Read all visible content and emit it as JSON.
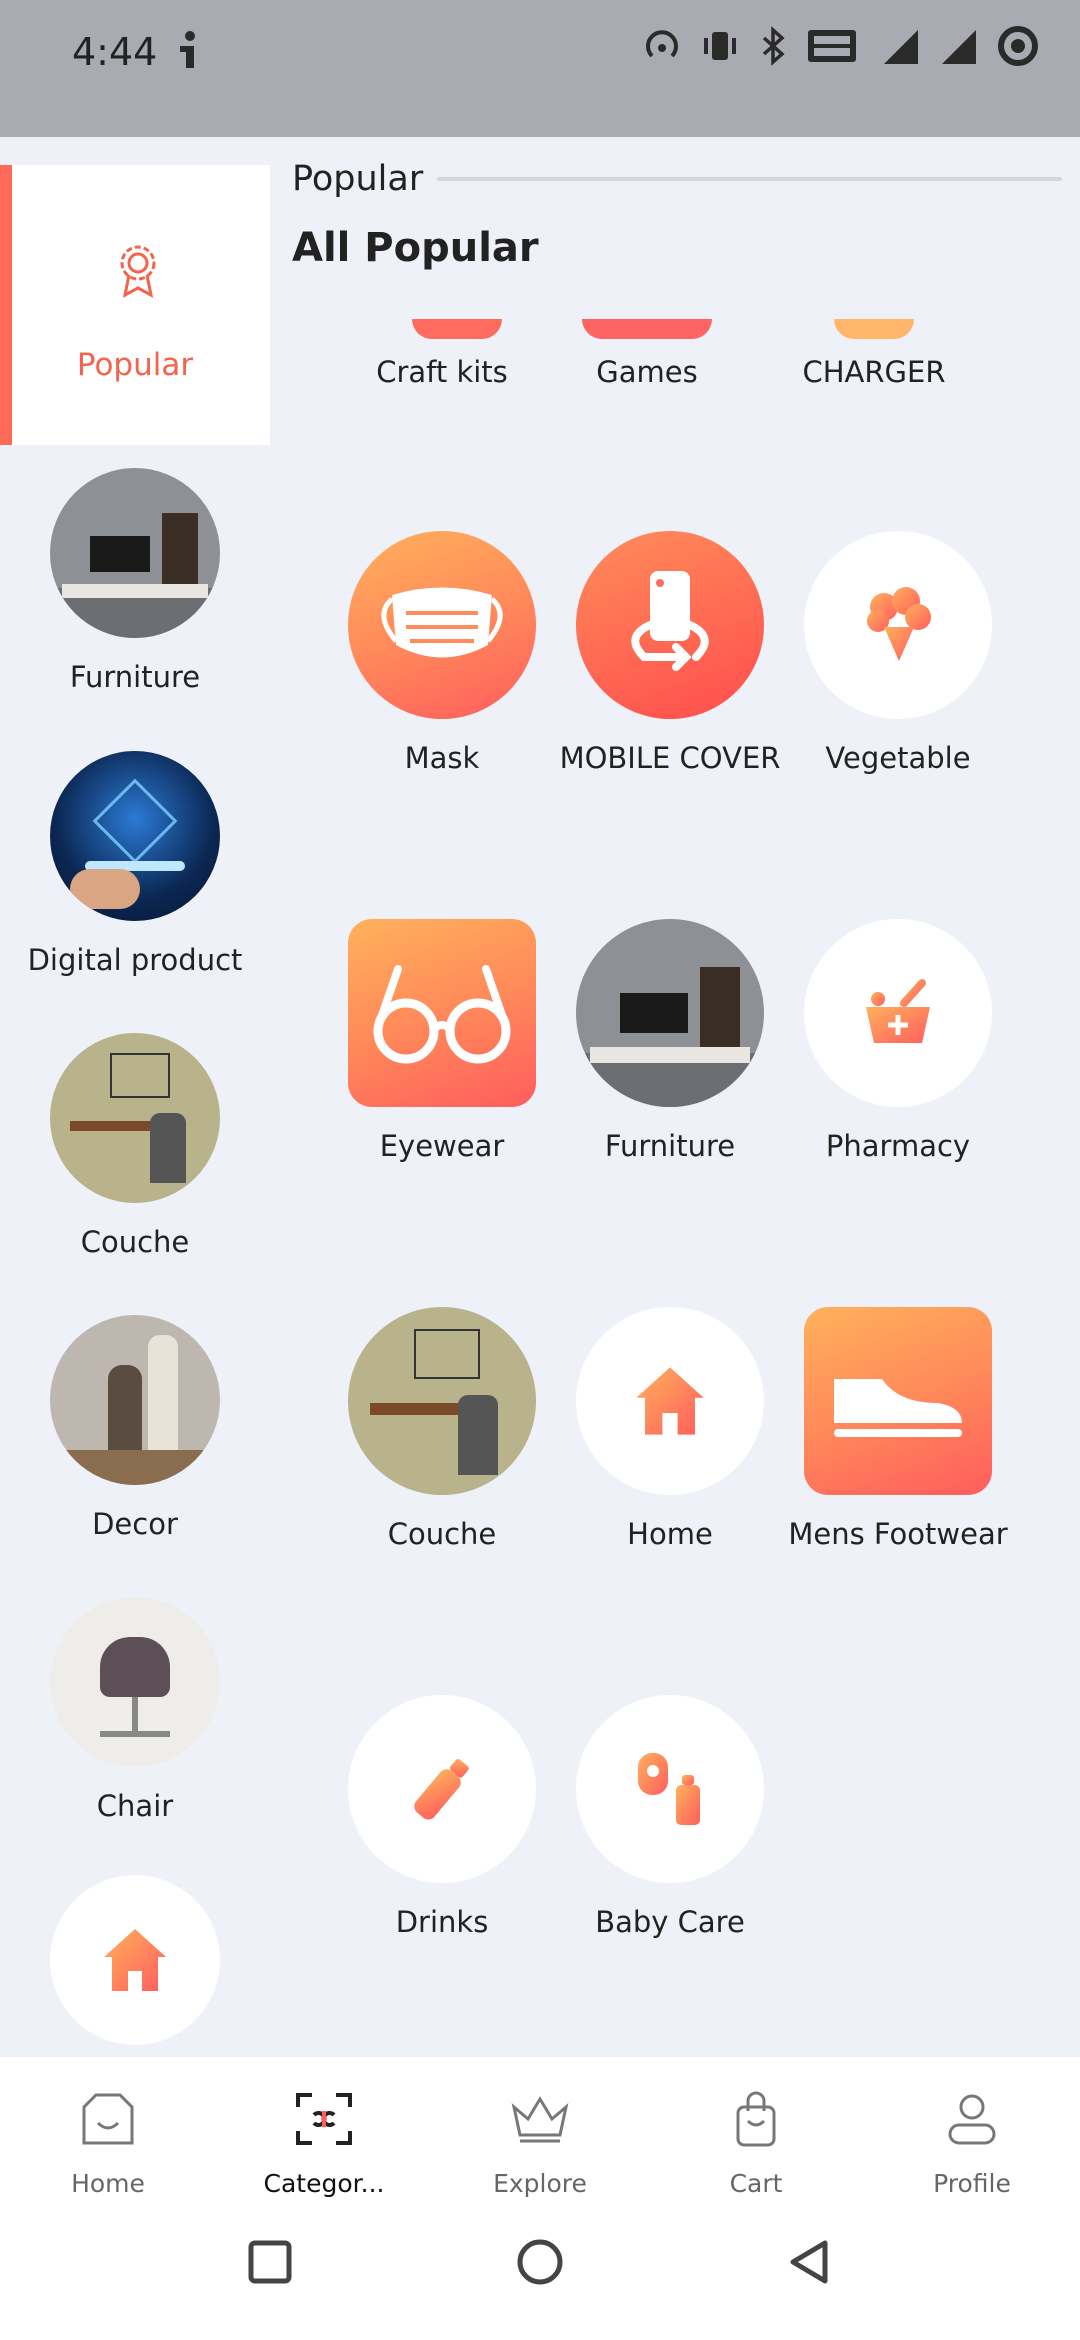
{
  "status_bar": {
    "time": "4:44"
  },
  "sidebar": {
    "active": {
      "label": "Popular"
    },
    "items": [
      {
        "label": "Furniture"
      },
      {
        "label": "Digital product"
      },
      {
        "label": "Couche"
      },
      {
        "label": "Decor"
      },
      {
        "label": "Chair"
      },
      {
        "label": ""
      }
    ]
  },
  "main": {
    "header_title": "Popular",
    "subtitle": "All Popular",
    "partial_row": [
      "Craft kits",
      "Games",
      "CHARGER"
    ],
    "grid": [
      {
        "label": "Mask",
        "icon": "mask-icon"
      },
      {
        "label": "MOBILE COVER",
        "icon": "mobile-cover-icon"
      },
      {
        "label": "Vegetable",
        "icon": "vegetable-icon"
      },
      {
        "label": "Eyewear",
        "icon": "eyewear-icon"
      },
      {
        "label": "Furniture",
        "icon": "furniture-image"
      },
      {
        "label": "Pharmacy",
        "icon": "pharmacy-icon"
      },
      {
        "label": "Couche",
        "icon": "couche-image"
      },
      {
        "label": "Home",
        "icon": "home-icon"
      },
      {
        "label": "Mens Footwear",
        "icon": "shoe-icon"
      },
      {
        "label": "Drinks",
        "icon": "bottle-icon"
      },
      {
        "label": "Baby Care",
        "icon": "baby-care-icon"
      }
    ]
  },
  "bottom_nav": {
    "items": [
      {
        "label": "Home"
      },
      {
        "label": "Categor..."
      },
      {
        "label": "Explore"
      },
      {
        "label": "Cart"
      },
      {
        "label": "Profile"
      }
    ]
  },
  "colors": {
    "accent": "#ff6b57",
    "background": "#eef1f7"
  }
}
